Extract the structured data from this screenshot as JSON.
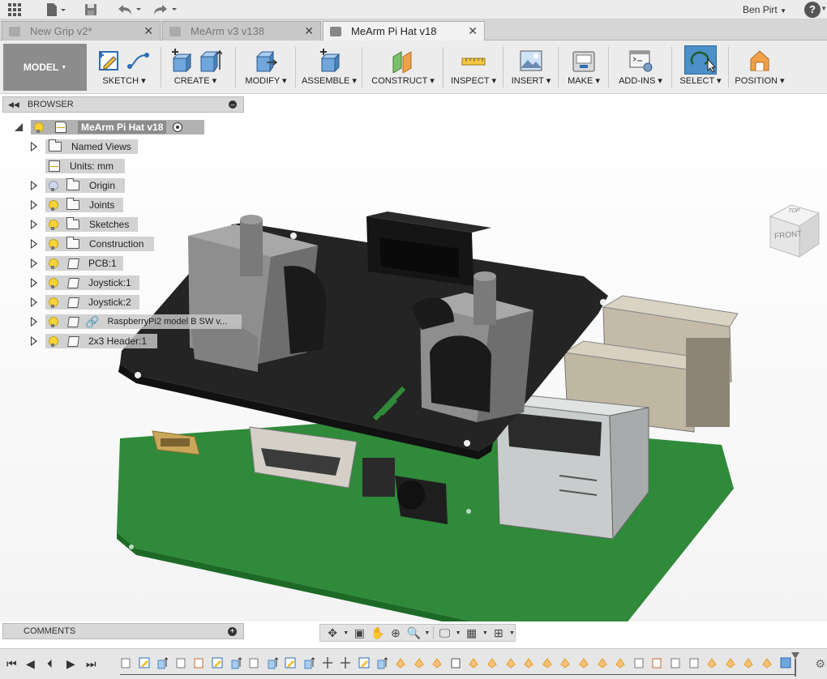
{
  "titlebar": {
    "user": "Ben Pirt",
    "help": "?"
  },
  "tabs": [
    {
      "label": "New Grip v2*",
      "active": false
    },
    {
      "label": "MeArm v3 v138",
      "active": false
    },
    {
      "label": "MeArm Pi Hat v18",
      "active": true
    }
  ],
  "toolbar": {
    "workspace": "MODEL",
    "groups": [
      {
        "label": "SKETCH"
      },
      {
        "label": "CREATE"
      },
      {
        "label": "MODIFY"
      },
      {
        "label": "ASSEMBLE"
      },
      {
        "label": "CONSTRUCT"
      },
      {
        "label": "INSPECT"
      },
      {
        "label": "INSERT"
      },
      {
        "label": "MAKE"
      },
      {
        "label": "ADD-INS"
      },
      {
        "label": "SELECT"
      },
      {
        "label": "POSITION"
      }
    ]
  },
  "browser": {
    "title": "BROWSER",
    "root": "MeArm Pi Hat v18",
    "items": [
      {
        "label": "Named Views"
      },
      {
        "label": "Units: mm"
      },
      {
        "label": "Origin"
      },
      {
        "label": "Joints"
      },
      {
        "label": "Sketches"
      },
      {
        "label": "Construction"
      },
      {
        "label": "PCB:1"
      },
      {
        "label": "Joystick:1"
      },
      {
        "label": "Joystick:2"
      },
      {
        "label": "RaspberryPi2 model B SW v..."
      },
      {
        "label": "2x3 Header:1"
      }
    ]
  },
  "viewcube": {
    "top": "TOP",
    "front": "FRONT"
  },
  "comments": {
    "title": "COMMENTS"
  },
  "colors": {
    "pcb_green": "#2f8a3a",
    "hat_black": "#1f1f1f",
    "joystick_gray": "#8a8a8a",
    "accent": "#1e6fb0"
  }
}
